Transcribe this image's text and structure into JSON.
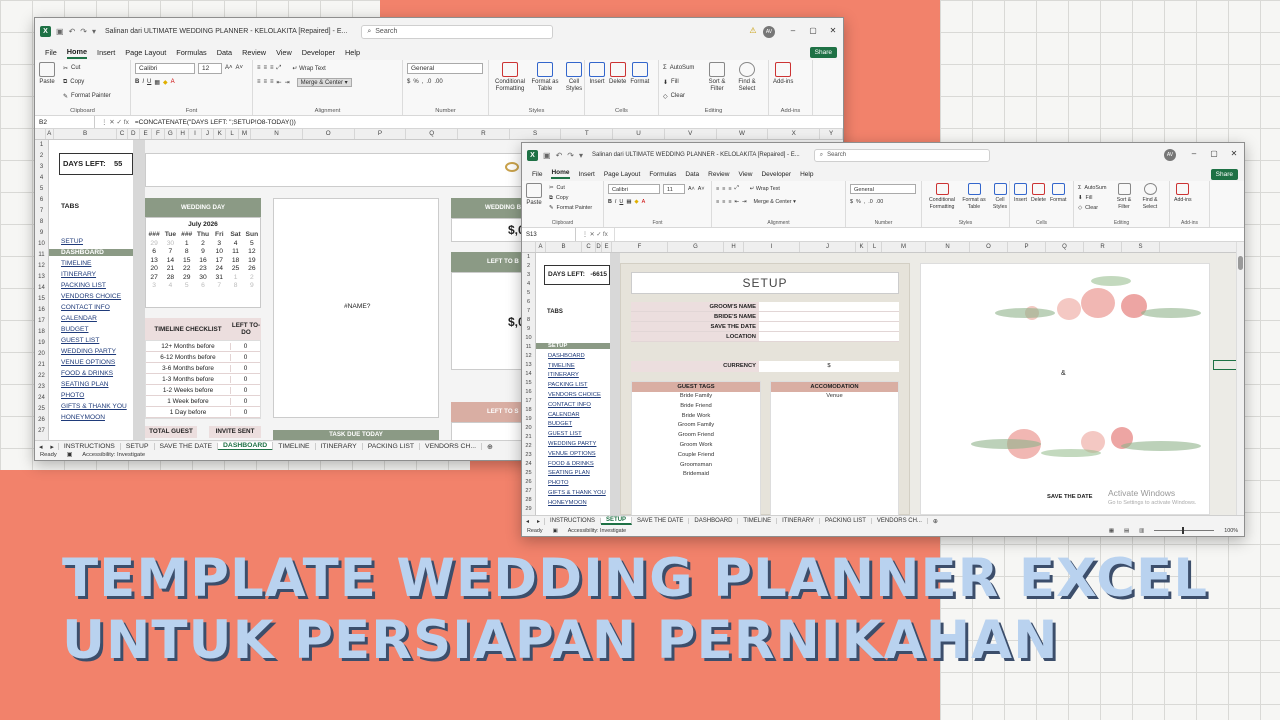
{
  "headline": {
    "line1": "TEMPLATE WEDDING PLANNER EXCEL",
    "line2": "UNTUK PERSIAPAN PERNIKAHAN"
  },
  "w1": {
    "title": "Salinan dari ULTIMATE WEDDING PLANNER - KELOLAKITA [Repaired] - E...",
    "search": "Search",
    "avatar": "AV",
    "menu": [
      "File",
      "Home",
      "Insert",
      "Page Layout",
      "Formulas",
      "Data",
      "Review",
      "View",
      "Developer",
      "Help"
    ],
    "share": "Share",
    "ribbon": {
      "clipboard": {
        "paste": "Paste",
        "cut": "Cut",
        "copy": "Copy",
        "format_painter": "Format Painter",
        "label": "Clipboard"
      },
      "font": {
        "name": "Calibri",
        "size": "12",
        "label": "Font"
      },
      "alignment": {
        "wrap": "Wrap Text",
        "merge": "Merge & Center",
        "label": "Alignment"
      },
      "number": {
        "format": "General",
        "label": "Number"
      },
      "styles": {
        "cond": "Conditional Formatting",
        "table": "Format as Table",
        "cell": "Cell Styles",
        "label": "Styles"
      },
      "cells": {
        "insert": "Insert",
        "delete": "Delete",
        "format": "Format",
        "label": "Cells"
      },
      "editing": {
        "autosum": "AutoSum",
        "fill": "Fill",
        "clear": "Clear",
        "sort": "Sort & Filter",
        "find": "Find & Select",
        "label": "Editing"
      },
      "addins": {
        "btn": "Add-ins",
        "label": "Add-ins"
      }
    },
    "namebox": "B2",
    "formula": "=CONCATENATE(\"DAYS LEFT:   \";SETUP!O8-TODAY())",
    "cols": [
      "A",
      "B",
      "C",
      "D",
      "E",
      "F",
      "G",
      "H",
      "I",
      "J",
      "K",
      "L",
      "M",
      "N",
      "O",
      "P",
      "Q",
      "R",
      "S",
      "T",
      "U",
      "V",
      "W",
      "X",
      "Y"
    ],
    "rows": [
      "1",
      "2",
      "3",
      "4",
      "5",
      "6",
      "7",
      "8",
      "9",
      "10",
      "11",
      "12",
      "13",
      "14",
      "15",
      "16",
      "17",
      "18",
      "19",
      "20",
      "21",
      "22",
      "23",
      "24",
      "25",
      "26",
      "27"
    ],
    "days_left_label": "DAYS LEFT:",
    "days_left_value": "55",
    "tabs_heading": "TABS",
    "nav": [
      "SETUP",
      "DASHBOARD",
      "TIMELINE",
      "ITINERARY",
      "PACKING LIST",
      "VENDORS CHOICE",
      "CONTACT INFO",
      "CALENDAR",
      "BUDGET",
      "GUEST LIST",
      "WEDDING PARTY",
      "VENUE OPTIONS",
      "FOOD & DRINKS",
      "SEATING PLAN",
      "PHOTO",
      "GIFTS & THANK YOU",
      "HONEYMOON"
    ],
    "wedding_day": "WEDDING DAY",
    "calendar": {
      "month": "July 2026",
      "dow": [
        "###",
        "Tue",
        "###",
        "Thu",
        "Fri",
        "Sat",
        "Sun"
      ],
      "days": [
        [
          "29",
          "30",
          "1",
          "2",
          "3",
          "4",
          "5"
        ],
        [
          "6",
          "7",
          "8",
          "9",
          "10",
          "11",
          "12"
        ],
        [
          "13",
          "14",
          "15",
          "16",
          "17",
          "18",
          "19"
        ],
        [
          "20",
          "21",
          "22",
          "23",
          "24",
          "25",
          "26"
        ],
        [
          "27",
          "28",
          "29",
          "30",
          "31",
          "1",
          "2"
        ],
        [
          "3",
          "4",
          "5",
          "6",
          "7",
          "8",
          "9"
        ]
      ]
    },
    "timeline": {
      "h1": "TIMELINE CHECKLIST",
      "h2": "LEFT TO-DO",
      "rows": [
        [
          "12+ Months before",
          "0"
        ],
        [
          "6-12 Months before",
          "0"
        ],
        [
          "3-6 Months before",
          "0"
        ],
        [
          "1-3 Months before",
          "0"
        ],
        [
          "1-2 Weeks before",
          "0"
        ],
        [
          "1 Week before",
          "0"
        ],
        [
          "1 Day before",
          "0"
        ]
      ]
    },
    "name_error": "#NAME?",
    "total_guest": "TOTAL GUEST",
    "invite_sent": "INVITE SENT",
    "task_due": "TASK DUE TODAY",
    "right1": "WEDDING B",
    "right1v": "$,0",
    "right2": "LEFT TO B",
    "right2v": "$,0",
    "right3": "LEFT TO S",
    "sheets": [
      "INSTRUCTIONS",
      "SETUP",
      "SAVE THE DATE",
      "DASHBOARD",
      "TIMELINE",
      "ITINERARY",
      "PACKING LIST",
      "VENDORS CH..."
    ],
    "status_ready": "Ready",
    "status_access": "Accessibility: Investigate"
  },
  "w2": {
    "title": "Salinan dari ULTIMATE WEDDING PLANNER - KELOLAKITA [Repaired] - E...",
    "search": "Search",
    "avatar": "AV",
    "menu": [
      "File",
      "Home",
      "Insert",
      "Page Layout",
      "Formulas",
      "Data",
      "Review",
      "View",
      "Developer",
      "Help"
    ],
    "share": "Share",
    "ribbon": {
      "paste": "Paste",
      "cut": "Cut",
      "copy": "Copy",
      "format_painter": "Format Painter",
      "clipboard": "Clipboard",
      "font": "Calibri",
      "size": "11",
      "font_label": "Font",
      "wrap": "Wrap Text",
      "merge": "Merge & Center",
      "align_label": "Alignment",
      "number": "General",
      "number_label": "Number",
      "cond": "Conditional Formatting",
      "table": "Format as Table",
      "cell": "Cell Styles",
      "styles_label": "Styles",
      "insert": "Insert",
      "delete": "Delete",
      "format": "Format",
      "cells_label": "Cells",
      "autosum": "AutoSum",
      "fill": "Fill",
      "clear": "Clear",
      "sort": "Sort & Filter",
      "find": "Find & Select",
      "edit_label": "Editing",
      "addins": "Add-ins",
      "addins_label": "Add-ins"
    },
    "namebox": "S13",
    "cols": [
      "A",
      "B",
      "C",
      "D",
      "E",
      "F",
      "G",
      "H",
      "I",
      "J",
      "K",
      "L",
      "M",
      "N",
      "O",
      "P",
      "Q",
      "R",
      "S"
    ],
    "rows": [
      "1",
      "2",
      "3",
      "4",
      "5",
      "6",
      "7",
      "8",
      "9",
      "10",
      "11",
      "12",
      "13",
      "14",
      "15",
      "16",
      "17",
      "18",
      "19",
      "20",
      "21",
      "22",
      "23",
      "24",
      "25",
      "26",
      "27",
      "28",
      "29"
    ],
    "days_left_label": "DAYS LEFT:",
    "days_left_value": "-6615",
    "tabs_heading": "TABS",
    "nav": [
      "SETUP",
      "DASHBOARD",
      "TIMELINE",
      "ITINERARY",
      "PACKING LIST",
      "VENDORS CHOICE",
      "CONTACT INFO",
      "CALENDAR",
      "BUDGET",
      "GUEST LIST",
      "WEDDING PARTY",
      "VENUE OPTIONS",
      "FOOD & DRINKS",
      "SEATING PLAN",
      "PHOTO",
      "GIFTS & THANK YOU",
      "HONEYMOON"
    ],
    "setup_title": "SETUP",
    "fields": [
      "GROOM'S NAME",
      "BRIDE'S NAME",
      "SAVE THE DATE",
      "LOCATION"
    ],
    "currency_label": "CURRENCY",
    "currency_value": "$",
    "guest_tags_h": "GUEST TAGS",
    "guest_tags": [
      "Bride Family",
      "Bride Friend",
      "Bride Work",
      "Groom Family",
      "Groom Friend",
      "Groom Work",
      "Couple Friend",
      "Groomsman",
      "Bridemaid"
    ],
    "accom_h": "ACCOMODATION",
    "accom": [
      "Venue"
    ],
    "amp": "&",
    "save_the_date": "SAVE THE DATE",
    "activate1": "Activate Windows",
    "activate2": "Go to Settings to activate Windows.",
    "sheets": [
      "INSTRUCTIONS",
      "SETUP",
      "SAVE THE DATE",
      "DASHBOARD",
      "TIMELINE",
      "ITINERARY",
      "PACKING LIST",
      "VENDORS CH..."
    ],
    "status_ready": "Ready",
    "status_access": "Accessibility: Investigate",
    "zoom": "100%"
  }
}
